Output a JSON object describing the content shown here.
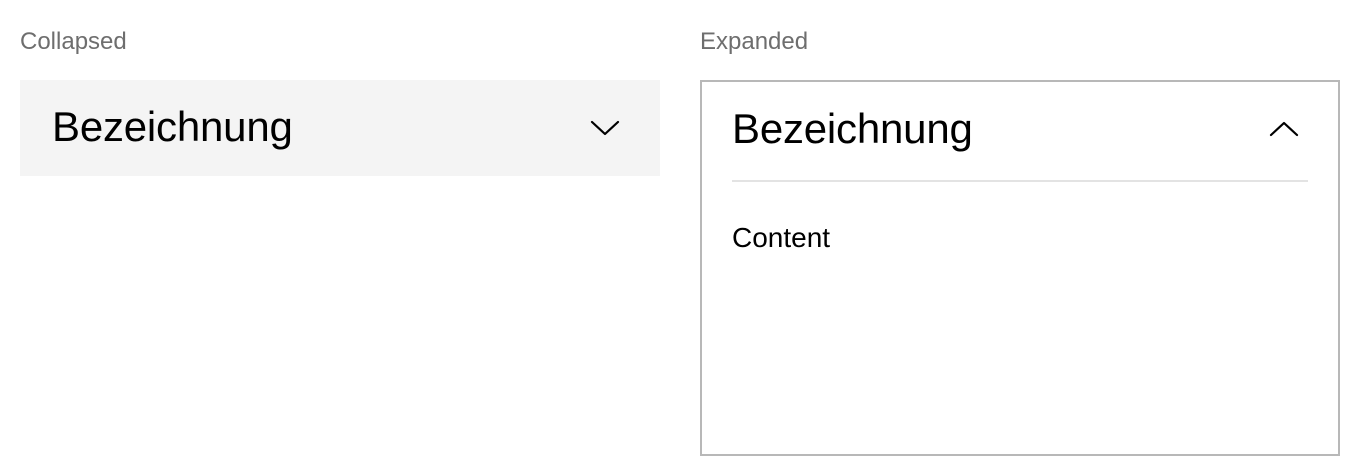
{
  "labels": {
    "collapsed": "Collapsed",
    "expanded": "Expanded"
  },
  "accordion_collapsed": {
    "title": "Bezeichnung",
    "state": "collapsed",
    "icon": "chevron-down-icon",
    "background": "#f4f4f4"
  },
  "accordion_expanded": {
    "title": "Bezeichnung",
    "state": "expanded",
    "icon": "chevron-up-icon",
    "content": "Content",
    "border_color": "#b8b8b8"
  }
}
